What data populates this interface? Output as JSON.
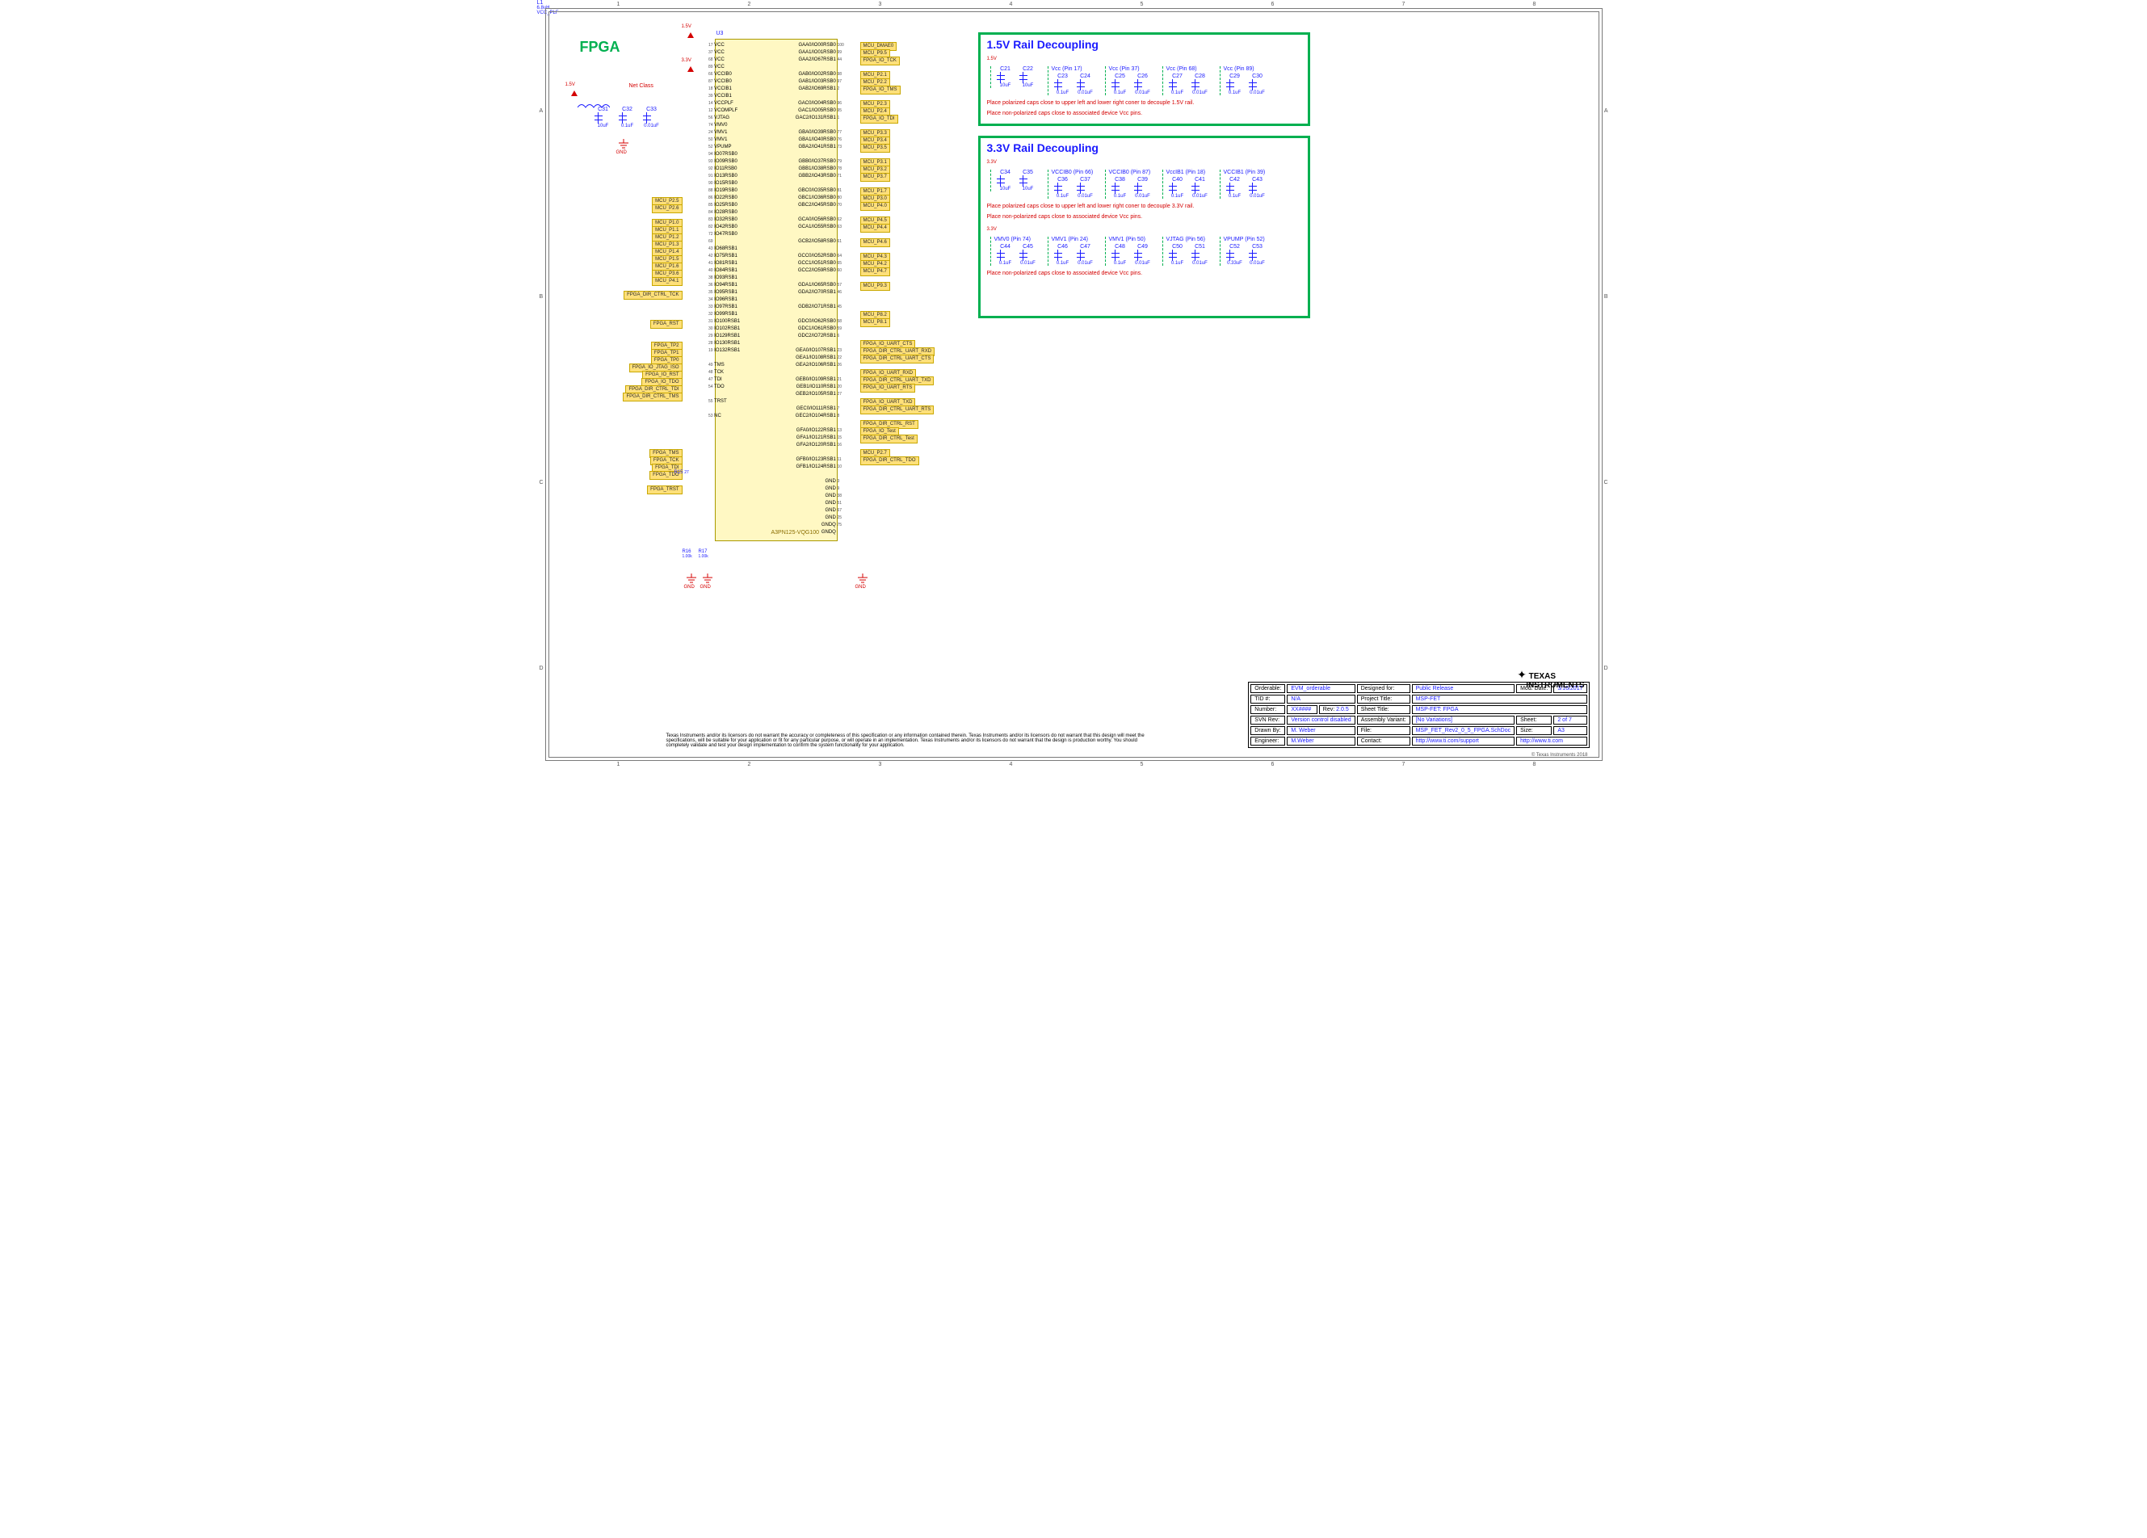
{
  "page_title": "FPGA",
  "chip": {
    "ref": "U3",
    "part": "A3PN125-VQG100",
    "left_pins": [
      {
        "num": "17",
        "name": "VCC"
      },
      {
        "num": "37",
        "name": "VCC"
      },
      {
        "num": "68",
        "name": "VCC"
      },
      {
        "num": "89",
        "name": "VCC"
      },
      {
        "num": "66",
        "name": "VCCIB0"
      },
      {
        "num": "87",
        "name": "VCCIB0"
      },
      {
        "num": "18",
        "name": "VCCIB1"
      },
      {
        "num": "39",
        "name": "VCCIB1"
      },
      {
        "num": "14",
        "name": "VCCPLF"
      },
      {
        "num": "12",
        "name": "VCOMPLF"
      },
      {
        "num": "56",
        "name": "VJTAG"
      },
      {
        "num": "74",
        "name": "VMV0"
      },
      {
        "num": "24",
        "name": "VMV1"
      },
      {
        "num": "50",
        "name": "VMV1"
      },
      {
        "num": "52",
        "name": "VPUMP"
      },
      {
        "num": "94",
        "name": "IO07RSB0"
      },
      {
        "num": "93",
        "name": "IO09RSB0"
      },
      {
        "num": "92",
        "name": "IO11RSB0"
      },
      {
        "num": "91",
        "name": "IO13RSB0"
      },
      {
        "num": "90",
        "name": "IO15RSB0"
      },
      {
        "num": "88",
        "name": "IO19RSB0"
      },
      {
        "num": "86",
        "name": "IO22RSB0"
      },
      {
        "num": "85",
        "name": "IO25RSB0"
      },
      {
        "num": "84",
        "name": "IO28RSB0"
      },
      {
        "num": "83",
        "name": "IO32RSB0"
      },
      {
        "num": "82",
        "name": "IO42RSB0"
      },
      {
        "num": "72",
        "name": "IO47RSB0"
      },
      {
        "num": "69",
        "name": ""
      },
      {
        "num": "43",
        "name": "IO68RSB1"
      },
      {
        "num": "42",
        "name": "IO75RSB1"
      },
      {
        "num": "41",
        "name": "IO81RSB1"
      },
      {
        "num": "40",
        "name": "IO84RSB1"
      },
      {
        "num": "38",
        "name": "IO93RSB1"
      },
      {
        "num": "36",
        "name": "IO94RSB1"
      },
      {
        "num": "35",
        "name": "IO95RSB1"
      },
      {
        "num": "34",
        "name": "IO96RSB1"
      },
      {
        "num": "33",
        "name": "IO97RSB1"
      },
      {
        "num": "32",
        "name": "IO99RSB1"
      },
      {
        "num": "31",
        "name": "IO100RSB1"
      },
      {
        "num": "30",
        "name": "IO102RSB1"
      },
      {
        "num": "29",
        "name": "IO129RSB1"
      },
      {
        "num": "28",
        "name": "IO130RSB1"
      },
      {
        "num": "19",
        "name": "IO132RSB1"
      },
      {
        "num": "",
        "name": ""
      },
      {
        "num": "49",
        "name": "TMS"
      },
      {
        "num": "48",
        "name": "TCK"
      },
      {
        "num": "47",
        "name": "TDI"
      },
      {
        "num": "54",
        "name": "TDO"
      },
      {
        "num": "",
        "name": ""
      },
      {
        "num": "55",
        "name": "TRST"
      },
      {
        "num": "",
        "name": ""
      },
      {
        "num": "53",
        "name": "NC"
      }
    ],
    "right_pins": [
      {
        "name": "GAA0/IO00RSB0",
        "num": "100"
      },
      {
        "name": "GAA1/IO01RSB0",
        "num": "99"
      },
      {
        "name": "GAA2/IO67RSB1",
        "num": "44"
      },
      {
        "name": "",
        "num": ""
      },
      {
        "name": "GAB0/IO02RSB0",
        "num": "98"
      },
      {
        "name": "GAB1/IO03RSB0",
        "num": "97"
      },
      {
        "name": "GAB2/IO69RSB1",
        "num": "2"
      },
      {
        "name": "",
        "num": ""
      },
      {
        "name": "GAC0/IO04RSB0",
        "num": "96"
      },
      {
        "name": "GAC1/IO05RSB0",
        "num": "95"
      },
      {
        "name": "GAC2/IO131RSB1",
        "num": "1"
      },
      {
        "name": "",
        "num": ""
      },
      {
        "name": "GBA0/IO39RSB0",
        "num": "77"
      },
      {
        "name": "GBA1/IO40RSB0",
        "num": "76"
      },
      {
        "name": "GBA2/IO41RSB1",
        "num": "73"
      },
      {
        "name": "",
        "num": ""
      },
      {
        "name": "GBB0/IO37RSB0",
        "num": "79"
      },
      {
        "name": "GBB1/IO38RSB0",
        "num": "78"
      },
      {
        "name": "GBB2/IO43RSB0",
        "num": "71"
      },
      {
        "name": "",
        "num": ""
      },
      {
        "name": "GBC0/IO35RSB0",
        "num": "81"
      },
      {
        "name": "GBC1/IO36RSB0",
        "num": "80"
      },
      {
        "name": "GBC2/IO45RSB0",
        "num": "70"
      },
      {
        "name": "",
        "num": ""
      },
      {
        "name": "GCA0/IO56RSB0",
        "num": "62"
      },
      {
        "name": "GCA1/IO55RSB0",
        "num": "63"
      },
      {
        "name": "",
        "num": ""
      },
      {
        "name": "GCB2/IO58RSB0",
        "num": "61"
      },
      {
        "name": "",
        "num": ""
      },
      {
        "name": "GCC0/IO52RSB0",
        "num": "64"
      },
      {
        "name": "GCC1/IO51RSB0",
        "num": "65"
      },
      {
        "name": "GCC2/IO59RSB0",
        "num": "60"
      },
      {
        "name": "",
        "num": ""
      },
      {
        "name": "GDA1/IO65RSB0",
        "num": "57"
      },
      {
        "name": "GDA2/IO70RSB1",
        "num": "46"
      },
      {
        "name": "",
        "num": ""
      },
      {
        "name": "GDB2/IO71RSB1",
        "num": "45"
      },
      {
        "name": "",
        "num": ""
      },
      {
        "name": "GDC0/IO62RSB0",
        "num": "58"
      },
      {
        "name": "GDC1/IO61RSB0",
        "num": "59"
      },
      {
        "name": "GDC2/IO72RSB1",
        "num": "6"
      },
      {
        "name": "",
        "num": ""
      },
      {
        "name": "GEA0/IO107RSB1",
        "num": "23"
      },
      {
        "name": "GEA1/IO108RSB1",
        "num": "22"
      },
      {
        "name": "GEA2/IO106RSB1",
        "num": "26"
      },
      {
        "name": "",
        "num": ""
      },
      {
        "name": "GEB0/IO109RSB1",
        "num": "21"
      },
      {
        "name": "GEB1/IO110RSB1",
        "num": "20"
      },
      {
        "name": "GEB2/IO105RSB1",
        "num": "27"
      },
      {
        "name": "",
        "num": ""
      },
      {
        "name": "GEC0/IO111RSB1",
        "num": "7"
      },
      {
        "name": "GEC2/IO104RSB1",
        "num": "8"
      },
      {
        "name": "",
        "num": ""
      },
      {
        "name": "GFA0/IO122RSB1",
        "num": "13"
      },
      {
        "name": "GFA1/IO121RSB1",
        "num": "15"
      },
      {
        "name": "GFA2/IO120RSB1",
        "num": "16"
      },
      {
        "name": "",
        "num": ""
      },
      {
        "name": "GFB0/IO123RSB1",
        "num": "11"
      },
      {
        "name": "GFB1/IO124RSB1",
        "num": "10"
      },
      {
        "name": "",
        "num": ""
      },
      {
        "name": "GND",
        "num": "3"
      },
      {
        "name": "GND",
        "num": "9"
      },
      {
        "name": "GND",
        "num": "38"
      },
      {
        "name": "GND",
        "num": "51"
      },
      {
        "name": "GND",
        "num": "67"
      },
      {
        "name": "GND",
        "num": "25"
      },
      {
        "name": "GNDQ",
        "num": "75"
      },
      {
        "name": "GNDQ",
        "num": ""
      }
    ]
  },
  "left_nets_1": [
    "MCU_P2.5",
    "MCU_P2.6",
    "",
    "MCU_P1.0",
    "MCU_P1.1",
    "MCU_P1.2",
    "MCU_P1.3",
    "MCU_P1.4",
    "MCU_P1.5",
    "MCU_P1.6",
    "MCU_P3.6",
    "MCU_P4.1"
  ],
  "left_nets_2": [
    "FPGA_DIR_CTRL_TCK",
    "",
    "",
    "",
    "FPGA_RST",
    "",
    "",
    "FPGA_TP2",
    "FPGA_TP1",
    "FPGA_TP0",
    "FPGA_IO_JTAG_ISO",
    "FPGA_IO_RST",
    "FPGA_IO_TDO",
    "FPGA_DIR_CTRL_TDI",
    "FPGA_DIR_CTRL_TMS"
  ],
  "left_nets_3": [
    "FPGA_TMS",
    "FPGA_TCK",
    "FPGA_TDI",
    "FPGA_TDO",
    "",
    "FPGA_TRST"
  ],
  "right_nets": [
    "MCU_DMAE0",
    "MCU_P9.5",
    "FPGA_IO_TCK",
    "",
    "MCU_P2.1",
    "MCU_P2.2",
    "FPGA_IO_TMS",
    "",
    "MCU_P2.3",
    "MCU_P2.4",
    "FPGA_IO_TDI",
    "",
    "MCU_P3.3",
    "MCU_P3.4",
    "MCU_P3.5",
    "",
    "MCU_P3.1",
    "MCU_P3.2",
    "MCU_P3.7",
    "",
    "MCU_P1.7",
    "MCU_P3.0",
    "MCU_P4.0",
    "",
    "MCU_P4.5",
    "MCU_P4.4",
    "",
    "MCU_P4.6",
    "",
    "MCU_P4.3",
    "MCU_P4.2",
    "MCU_P4.7",
    "",
    "MCU_P9.3",
    "",
    "",
    "",
    "MCU_P8.2",
    "MCU_P8.1",
    "",
    "",
    "FPGA_IO_UART_CTS",
    "FPGA_DIR_CTRL_UART_RXD",
    "FPGA_DIR_CTRL_UART_CTS",
    "",
    "FPGA_IO_UART_RXD",
    "FPGA_DIR_CTRL_UART_TXD",
    "FPGA_IO_UART_RTS",
    "",
    "FPGA_IO_UART_TXD",
    "FPGA_DIR_CTRL_UART_RTS",
    "",
    "FPGA_DIR_CTRL_RST",
    "FPGA_IO_Test",
    "FPGA_DIR_CTRL_Test",
    "",
    "MCU_P2.7",
    "FPGA_DIR_CTRL_TDO"
  ],
  "passives": {
    "L1": {
      "ref": "L1",
      "val": "6.8uH"
    },
    "C31": {
      "ref": "C31",
      "val": "10uF"
    },
    "C32": {
      "ref": "C32",
      "val": "0.1uF"
    },
    "C33": {
      "ref": "C33",
      "val": "0.01uF"
    },
    "R15": {
      "ref": "R15",
      "val": "27"
    },
    "R16": {
      "ref": "R16",
      "val": "1.00k"
    },
    "R17": {
      "ref": "R17",
      "val": "1.00k"
    }
  },
  "rails": {
    "v15": "1.5V",
    "v33": "3.3V",
    "gnd": "GND",
    "vcc_plf": "VCC_PLF",
    "netclass": "Net Class"
  },
  "decoup15": {
    "title": "1.5V Rail Decoupling",
    "groups": [
      {
        "hdr": "",
        "caps": [
          {
            "r": "C21",
            "v": "10uF"
          },
          {
            "r": "C22",
            "v": "10uF"
          }
        ]
      },
      {
        "hdr": "Vcc (Pin 17)",
        "caps": [
          {
            "r": "C23",
            "v": "0.1uF"
          },
          {
            "r": "C24",
            "v": "0.01uF"
          }
        ]
      },
      {
        "hdr": "Vcc (Pin 37)",
        "caps": [
          {
            "r": "C25",
            "v": "0.1uF"
          },
          {
            "r": "C26",
            "v": "0.01uF"
          }
        ]
      },
      {
        "hdr": "Vcc (Pin 68)",
        "caps": [
          {
            "r": "C27",
            "v": "0.1uF"
          },
          {
            "r": "C28",
            "v": "0.01uF"
          }
        ]
      },
      {
        "hdr": "Vcc (Pin 89)",
        "caps": [
          {
            "r": "C29",
            "v": "0.1uF"
          },
          {
            "r": "C30",
            "v": "0.01uF"
          }
        ]
      }
    ],
    "note1": "Place polarized caps close to upper left and lower right coner to decouple 1.5V rail.",
    "note2": "Place non-polarized caps close to associated device Vcc pins."
  },
  "decoup33": {
    "title": "3.3V Rail Decoupling",
    "row1_groups": [
      {
        "hdr": "",
        "caps": [
          {
            "r": "C34",
            "v": "10uF"
          },
          {
            "r": "C35",
            "v": "10uF"
          }
        ]
      },
      {
        "hdr": "VCCIB0 (Pin 66)",
        "caps": [
          {
            "r": "C36",
            "v": "0.1uF"
          },
          {
            "r": "C37",
            "v": "0.01uF"
          }
        ]
      },
      {
        "hdr": "VCCIB0 (Pin 87)",
        "caps": [
          {
            "r": "C38",
            "v": "0.1uF"
          },
          {
            "r": "C39",
            "v": "0.01uF"
          }
        ]
      },
      {
        "hdr": "VccIB1 (Pin 18)",
        "caps": [
          {
            "r": "C40",
            "v": "0.1uF"
          },
          {
            "r": "C41",
            "v": "0.01uF"
          }
        ]
      },
      {
        "hdr": "VCCIB1 (Pin 39)",
        "caps": [
          {
            "r": "C42",
            "v": "0.1uF"
          },
          {
            "r": "C43",
            "v": "0.01uF"
          }
        ]
      }
    ],
    "row1_note1": "Place polarized caps close to upper left and lower right coner to decouple 3.3V rail.",
    "row1_note2": "Place non-polarized caps close to associated device Vcc pins.",
    "row2_groups": [
      {
        "hdr": "VMV0 (Pin 74)",
        "caps": [
          {
            "r": "C44",
            "v": "0.1uF"
          },
          {
            "r": "C45",
            "v": "0.01uF"
          }
        ]
      },
      {
        "hdr": "VMV1 (Pin 24)",
        "caps": [
          {
            "r": "C46",
            "v": "0.1uF"
          },
          {
            "r": "C47",
            "v": "0.01uF"
          }
        ]
      },
      {
        "hdr": "VMV1 (Pin 50)",
        "caps": [
          {
            "r": "C48",
            "v": "0.1uF"
          },
          {
            "r": "C49",
            "v": "0.01uF"
          }
        ]
      },
      {
        "hdr": "VJTAG (Pin 56)",
        "caps": [
          {
            "r": "C50",
            "v": "0.1uF"
          },
          {
            "r": "C51",
            "v": "0.01uF"
          }
        ]
      },
      {
        "hdr": "VPUMP (Pin 52)",
        "caps": [
          {
            "r": "C52",
            "v": "0.33uF"
          },
          {
            "r": "C53",
            "v": "0.01uF"
          }
        ]
      }
    ],
    "row2_note": "Place non-polarized caps close to associated device Vcc pins."
  },
  "titleblock": {
    "orderable_l": "Orderable:",
    "orderable_v": "EVM_orderable",
    "designed_l": "Designed for:",
    "designed_v": "Public Release",
    "moddate_l": "Mod. Date:",
    "moddate_v": "3/16/2017",
    "tid_l": "TID #:",
    "tid_v": "N/A",
    "proj_l": "Project Title:",
    "proj_v": "MSP-FET",
    "num_l": "Number:",
    "num_v": "XX####",
    "rev_l": "Rev:",
    "rev_v": "2.0.5",
    "sheet_title_l": "Sheet Title:",
    "sheet_title_v": "MSP-FET: FPGA",
    "svn_l": "SVN Rev:",
    "svn_v": "Version control disabled",
    "asm_l": "Assembly Variant:",
    "asm_v": "[No Variations]",
    "sheet_l": "Sheet:",
    "sheet_v": "2 of 7",
    "drawn_l": "Drawn By:",
    "drawn_v": "M. Weber",
    "file_l": "File:",
    "file_v": "MSP_FET_Rev2_0_5_FPGA.SchDoc",
    "size_l": "Size:",
    "size_v": "A3",
    "eng_l": "Engineer:",
    "eng_v": "M.Weber",
    "contact_l": "Contact:",
    "contact_v": "http://www.ti.com/support",
    "url": "http://www.ti.com",
    "copyright": "© Texas Instruments  2018",
    "logo1": "TEXAS",
    "logo2": "INSTRUMENTS"
  },
  "disclaimer": "Texas Instruments and/or its licensors do not warrant the accuracy or completeness of this specification or any information contained therein. Texas Instruments and/or its licensors do not warrant that this design will meet the specifications, will be suitable for your application or fit for any particular purpose, or will operate in an implementation. Texas Instruments and/or its licensors do not warrant that the design is production worthy. You should completely validate and test your design implementation to confirm the system functionality for your application.",
  "grid_cols": [
    "1",
    "2",
    "3",
    "4",
    "5",
    "6",
    "7",
    "8"
  ],
  "grid_rows": [
    "A",
    "B",
    "C",
    "D"
  ]
}
